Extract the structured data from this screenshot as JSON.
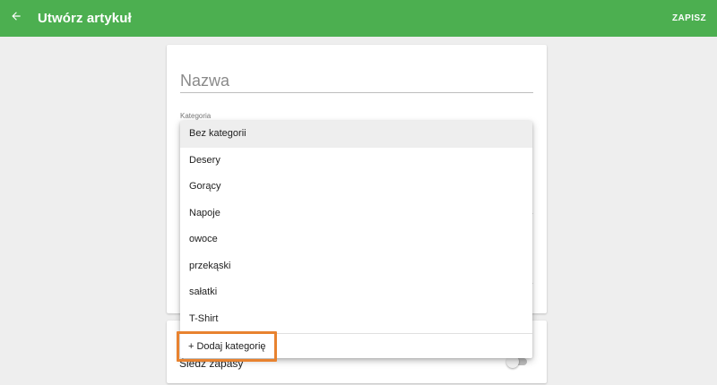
{
  "app_bar": {
    "title": "Utwórz artykuł",
    "save_label": "ZAPISZ",
    "back_icon": "arrow-left-icon",
    "color": "#4caf50"
  },
  "form": {
    "name_placeholder": "Nazwa",
    "category_label": "Kategoria",
    "stock_label": "Śledź zapasy",
    "stock_tracking_enabled": false
  },
  "dropdown": {
    "selected": "Bez kategorii",
    "items": [
      "Bez kategorii",
      "Desery",
      "Gorący",
      "Napoje",
      "owoce",
      "przekąski",
      "sałatki",
      "T-Shirt"
    ],
    "add_label": "+ Dodaj kategorię",
    "highlight_color": "#e8822f"
  }
}
